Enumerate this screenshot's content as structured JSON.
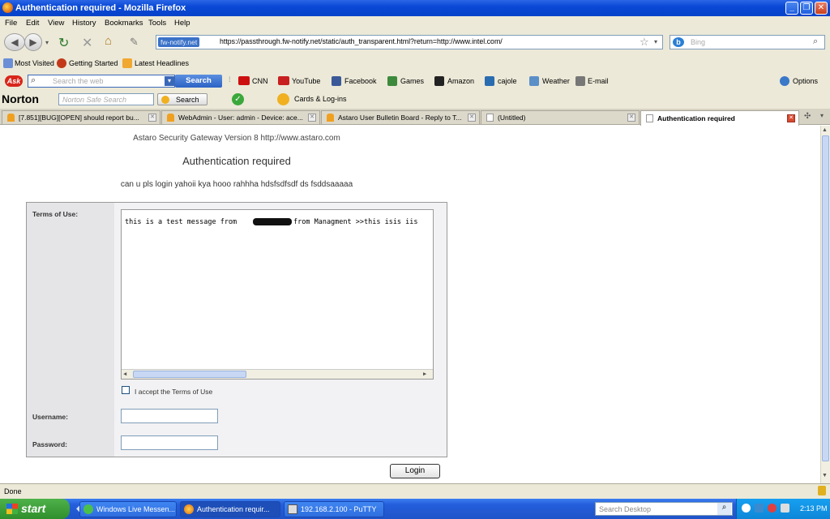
{
  "window": {
    "title": "Authentication required - Mozilla Firefox",
    "minimize": "_",
    "maximize": "❐",
    "close": "✕"
  },
  "menu": [
    "File",
    "Edit",
    "View",
    "History",
    "Bookmarks",
    "Tools",
    "Help"
  ],
  "nav": {
    "site_badge": "fw-notify.net",
    "url": "https://passthrough.fw-notify.net/static/auth_transparent.html?return=http://www.intel.com/",
    "search_placeholder": "Bing"
  },
  "bookmarks": [
    "Most Visited",
    "Getting Started",
    "Latest Headlines"
  ],
  "ask_toolbar": {
    "logo": "Ask",
    "search_placeholder": "Search the web",
    "search_button": "Search",
    "items": [
      "CNN",
      "YouTube",
      "Facebook",
      "Games",
      "Amazon",
      "cajole",
      "Weather",
      "E-mail"
    ],
    "options": "Options"
  },
  "norton_toolbar": {
    "logo": "Norton",
    "search_placeholder": "Norton Safe Search",
    "search_button": "Search",
    "cards": "Cards & Log-ins"
  },
  "tabs": [
    {
      "label": "[7.851][BUG][OPEN] should report bu..."
    },
    {
      "label": "WebAdmin - User: admin - Device: ace..."
    },
    {
      "label": "Astaro User Bulletin Board - Reply to T..."
    },
    {
      "label": "(Untitled)"
    },
    {
      "label": "Authentication required"
    }
  ],
  "page": {
    "gateway_line": "Astaro Security Gateway Version 8 http://www.astaro.com",
    "heading": "Authentication required",
    "message": "can u pls login yahoii kya hooo rahhha hdsfsdfsdf ds fsddsaaaaa",
    "terms_label": "Terms of Use:",
    "terms_text_1": "this is a test message from",
    "terms_text_2": "from Managment >>this isis iis",
    "accept_label": "I accept the Terms of Use",
    "username_label": "Username:",
    "password_label": "Password:",
    "login_button": "Login"
  },
  "status": {
    "text": "Done"
  },
  "taskbar": {
    "start": "start",
    "items": [
      "Windows Live Messen...",
      "Authentication requir...",
      "192.168.2.100 - PuTTY"
    ],
    "search_placeholder": "Search Desktop",
    "clock": "2:13 PM"
  }
}
